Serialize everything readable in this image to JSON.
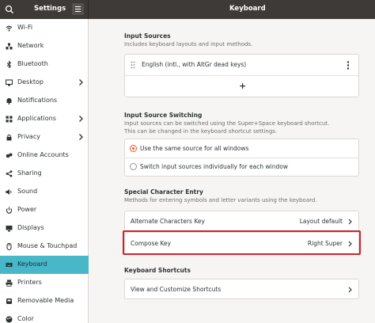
{
  "window": {
    "app_title": "Settings",
    "page_title": "Keyboard"
  },
  "sidebar": {
    "items": [
      {
        "label": "Wi-Fi",
        "icon": "wifi-icon",
        "chevron": false,
        "active": false
      },
      {
        "label": "Network",
        "icon": "network-icon",
        "chevron": false,
        "active": false
      },
      {
        "label": "Bluetooth",
        "icon": "bluetooth-icon",
        "chevron": false,
        "active": false
      },
      {
        "label": "Desktop",
        "icon": "desktop-icon",
        "chevron": true,
        "active": false
      },
      {
        "label": "Notifications",
        "icon": "bell-icon",
        "chevron": false,
        "active": false
      },
      {
        "label": "Applications",
        "icon": "applications-icon",
        "chevron": true,
        "active": false
      },
      {
        "label": "Privacy",
        "icon": "privacy-icon",
        "chevron": true,
        "active": false
      },
      {
        "label": "Online Accounts",
        "icon": "online-accounts-icon",
        "chevron": false,
        "active": false
      },
      {
        "label": "Sharing",
        "icon": "share-icon",
        "chevron": false,
        "active": false
      },
      {
        "label": "Sound",
        "icon": "speaker-icon",
        "chevron": false,
        "active": false
      },
      {
        "label": "Power",
        "icon": "power-icon",
        "chevron": false,
        "active": false
      },
      {
        "label": "Displays",
        "icon": "display-icon",
        "chevron": false,
        "active": false
      },
      {
        "label": "Mouse & Touchpad",
        "icon": "mouse-icon",
        "chevron": false,
        "active": false
      },
      {
        "label": "Keyboard",
        "icon": "keyboard-icon",
        "chevron": false,
        "active": true
      },
      {
        "label": "Printers",
        "icon": "printer-icon",
        "chevron": false,
        "active": false
      },
      {
        "label": "Removable Media",
        "icon": "media-icon",
        "chevron": false,
        "active": false
      },
      {
        "label": "Color",
        "icon": "color-icon",
        "chevron": false,
        "active": false
      }
    ]
  },
  "input_sources": {
    "title": "Input Sources",
    "description": "Includes keyboard layouts and input methods.",
    "source_label": "English (intl., with AltGr dead keys)",
    "add_label": "+"
  },
  "input_switching": {
    "title": "Input Source Switching",
    "description_line1": "Input sources can be switched using the Super+Space keyboard shortcut.",
    "description_line2": "This can be changed in the keyboard shortcut settings.",
    "option_same": "Use the same source for all windows",
    "option_individual": "Switch input sources individually for each window",
    "selected": "same"
  },
  "special_chars": {
    "title": "Special Character Entry",
    "description": "Methods for entering symbols and letter variants using the keyboard.",
    "alternate_label": "Alternate Characters Key",
    "alternate_value": "Layout default",
    "compose_label": "Compose Key",
    "compose_value": "Right Super"
  },
  "shortcuts": {
    "title": "Keyboard Shortcuts",
    "view_label": "View and Customize Shortcuts"
  },
  "colors": {
    "accent": "#e95420",
    "sidebar_active": "#48b8c8",
    "highlight_box": "#d4202a"
  }
}
